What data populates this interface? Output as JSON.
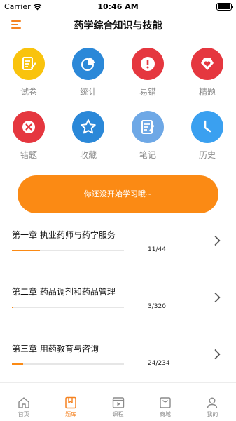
{
  "status_bar": {
    "carrier": "Carrier",
    "time": "10:46 AM"
  },
  "header": {
    "title": "药学综合知识与技能"
  },
  "grid": [
    {
      "label": "试卷",
      "icon": "exam-paper-icon",
      "color": "#f9c30d"
    },
    {
      "label": "统计",
      "icon": "pie-chart-icon",
      "color": "#2b88d8"
    },
    {
      "label": "易错",
      "icon": "exclamation-icon",
      "color": "#e5373f"
    },
    {
      "label": "精题",
      "icon": "diamond-heart-icon",
      "color": "#e5373f"
    },
    {
      "label": "错题",
      "icon": "x-circle-icon",
      "color": "#e5373f"
    },
    {
      "label": "收藏",
      "icon": "star-icon",
      "color": "#2b88d8"
    },
    {
      "label": "笔记",
      "icon": "notebook-icon",
      "color": "#6ea8e6"
    },
    {
      "label": "历史",
      "icon": "clock-icon",
      "color": "#3aa0f0"
    }
  ],
  "start_button": {
    "label": "你还没开始学习哦~"
  },
  "chapters": [
    {
      "title": "第一章 执业药师与药学服务",
      "count": "11/44",
      "done": 11,
      "total": 44
    },
    {
      "title": "第二章 药品调剂和药品管理",
      "count": "3/320",
      "done": 3,
      "total": 320
    },
    {
      "title": "第三章 用药教育与咨询",
      "count": "24/234",
      "done": 24,
      "total": 234
    }
  ],
  "tabs": [
    {
      "label": "首页",
      "icon": "home-icon",
      "active": false
    },
    {
      "label": "题库",
      "icon": "question-bank-icon",
      "active": true
    },
    {
      "label": "课程",
      "icon": "video-icon",
      "active": false
    },
    {
      "label": "商城",
      "icon": "shop-icon",
      "active": false
    },
    {
      "label": "我的",
      "icon": "profile-icon",
      "active": false
    }
  ],
  "colors": {
    "accent": "#f58220",
    "button": "#fb8a14"
  }
}
